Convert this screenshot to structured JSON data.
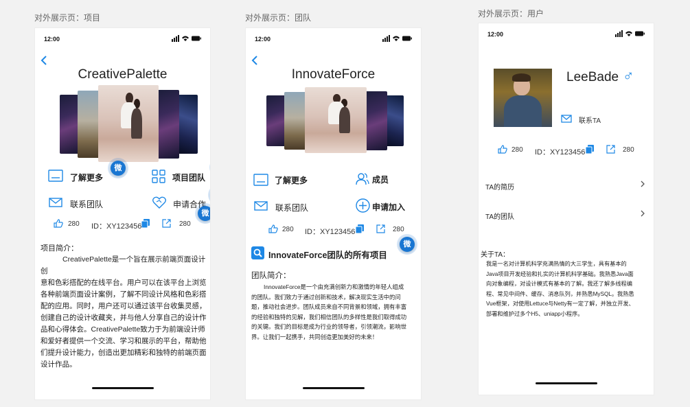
{
  "status_time": "12:00",
  "captions": {
    "project": "对外展示页：项目",
    "team": "对外展示页：团队",
    "user": "对外展示页：用户"
  },
  "project_page": {
    "title": "CreativePalette",
    "learn_more": "了解更多",
    "project_team": "项目团队",
    "contact_team": "联系团队",
    "apply_cooperation": "申请合作",
    "likes": "280",
    "id_label": "ID：XY123456",
    "shares": "280",
    "wei": "微",
    "intro_label": "项目简介：",
    "intro_lines": [
      "CreativePalette是一个旨在展示前端页面设计创",
      "意和色彩搭配的在线平台。用户可以在该平台上浏览",
      "各种前端页面设计案例，了解不同设计风格和色彩搭",
      "配的应用。同时，用户还可以通过该平台收集灵感，",
      "创建自己的设计收藏夹，并与他人分享自己的设计作",
      "品和心得体会。CreativePalette致力于为前端设计师",
      "和爱好者提供一个交流、学习和展示的平台，帮助他",
      "们提升设计能力，创造出更加精彩和独特的前端页面",
      "设计作品。"
    ]
  },
  "team_page": {
    "title": "InnovateForce",
    "learn_more": "了解更多",
    "members": "成员",
    "contact_team": "联系团队",
    "apply_join": "申请加入",
    "likes": "280",
    "id_label": "ID：XY123456",
    "shares": "280",
    "wei": "微",
    "all_projects": "InnovateForce团队的所有项目",
    "intro_label": "团队简介：",
    "intro_lines": [
      "InnovateForce是一个由充满创新力和激情的年轻人组成",
      "的团队。我们致力于通过创新和技术，解决现实生活中的问",
      "题，推动社会进步。团队成员来自不同背景和领域，拥有丰富",
      "的经验和独特的见解，我们相信团队的多样性是我们取得成功",
      "的关键。我们的目标是成为行业的领导者，引领潮流，影响世",
      "界。让我们一起携手，共同创造更加美好的未来！"
    ]
  },
  "user_page": {
    "name": "LeeBade",
    "gender_symbol": "♂",
    "contact": "联系TA",
    "likes": "280",
    "id_label": "ID：XY123456",
    "shares": "280",
    "resume": "TA的简历",
    "team": "TA的团队",
    "about_label": "关于TA：",
    "about_lines": [
      "我是一名对计算机科学充满热情的大三学生，具有基本的",
      "Java项目开发经验和扎实的计算机科学基础。我熟悉Java面",
      "向对象编程，对设计模式有基本的了解。我还了解多线程编",
      "程、常见中间件、缓存、消息队列，并熟悉MySQL。我熟悉",
      "Vue框架，对使用Lettuce与Netty有一定了解，并独立开发、",
      "部署和维护过多个H5、uniapp小程序。"
    ]
  },
  "colors": {
    "accent": "#1976d2",
    "icon_blue": "#1e88e5"
  }
}
